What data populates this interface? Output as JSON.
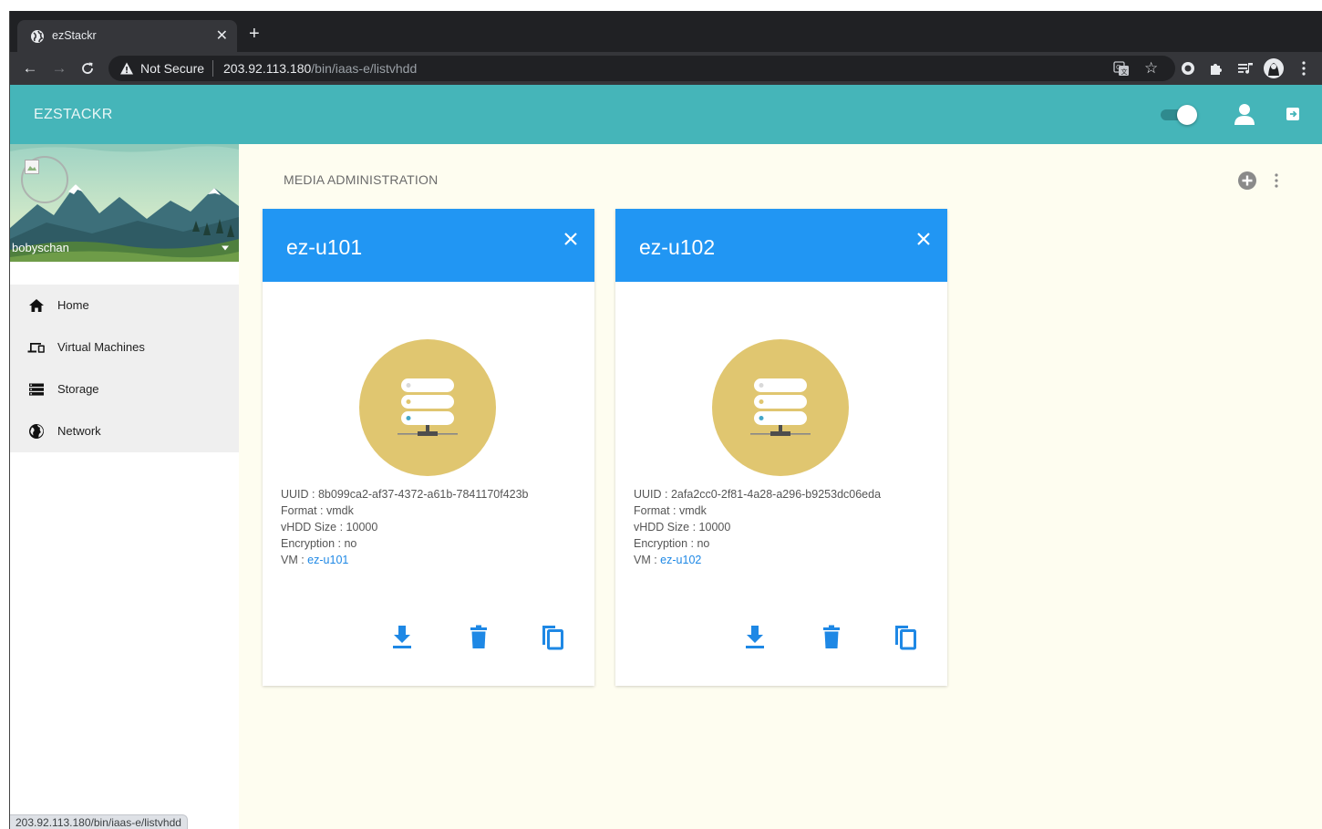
{
  "browser": {
    "tab_title": "ezStackr",
    "security_label": "Not Secure",
    "url_host": "203.92.113.180",
    "url_path": "/bin/iaas-e/listvhdd",
    "status_url": "203.92.113.180/bin/iaas-e/listvhdd"
  },
  "app": {
    "brand": "EZSTACKR"
  },
  "sidebar": {
    "username": "bobyschan",
    "items": [
      {
        "label": "Home",
        "icon": "home-icon"
      },
      {
        "label": "Virtual Machines",
        "icon": "devices-icon"
      },
      {
        "label": "Storage",
        "icon": "storage-icon"
      },
      {
        "label": "Network",
        "icon": "globe-icon"
      }
    ]
  },
  "main": {
    "section_title": "MEDIA ADMINISTRATION",
    "cards": [
      {
        "title": "ez-u101",
        "uuid_label": "UUID : ",
        "uuid": "8b099ca2-af37-4372-a61b-7841170f423b",
        "format_label": "Format : ",
        "format": "vmdk",
        "size_label": "vHDD Size : ",
        "size": "10000",
        "encryption_label": "Encryption : ",
        "encryption": "no",
        "vm_label": "VM : ",
        "vm": "ez-u101"
      },
      {
        "title": "ez-u102",
        "uuid_label": "UUID : ",
        "uuid": "2afa2cc0-2f81-4a28-a296-b9253dc06eda",
        "format_label": "Format : ",
        "format": "vmdk",
        "size_label": "vHDD Size : ",
        "size": "10000",
        "encryption_label": "Encryption : ",
        "encryption": "no",
        "vm_label": "VM : ",
        "vm": "ez-u102"
      }
    ]
  },
  "colors": {
    "appbar": "#45b5b9",
    "card_header": "#2196f3",
    "disk_circle": "#e0c670",
    "action_icons": "#1e88e5",
    "content_bg": "#fefdf0"
  }
}
